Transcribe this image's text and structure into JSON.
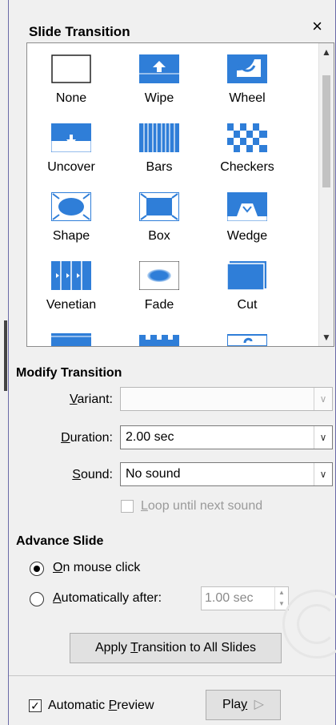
{
  "panel": {
    "title": "Slide Transition",
    "close_glyph": "×"
  },
  "transitions": [
    {
      "label": "None",
      "icon": "none-transition-icon"
    },
    {
      "label": "Wipe",
      "icon": "wipe-transition-icon"
    },
    {
      "label": "Wheel",
      "icon": "wheel-transition-icon"
    },
    {
      "label": "Uncover",
      "icon": "uncover-transition-icon"
    },
    {
      "label": "Bars",
      "icon": "bars-transition-icon"
    },
    {
      "label": "Checkers",
      "icon": "checkers-transition-icon"
    },
    {
      "label": "Shape",
      "icon": "shape-transition-icon"
    },
    {
      "label": "Box",
      "icon": "box-transition-icon"
    },
    {
      "label": "Wedge",
      "icon": "wedge-transition-icon"
    },
    {
      "label": "Venetian",
      "icon": "venetian-transition-icon"
    },
    {
      "label": "Fade",
      "icon": "fade-transition-icon"
    },
    {
      "label": "Cut",
      "icon": "cut-transition-icon"
    }
  ],
  "modify": {
    "heading": "Modify Transition",
    "variant_label": "Variant:",
    "variant_value": "",
    "duration_label": "Duration:",
    "duration_value": "2.00 sec",
    "sound_label": "Sound:",
    "sound_value": "No sound",
    "loop_label": "Loop until next sound",
    "loop_checked": false
  },
  "advance": {
    "heading": "Advance Slide",
    "on_click_label": "On mouse click",
    "on_click_selected": true,
    "auto_label": "Automatically after:",
    "auto_value": "1.00 sec",
    "apply_all_label": "Apply Transition to All Slides"
  },
  "footer": {
    "preview_label": "Automatic Preview",
    "preview_checked": true,
    "play_label": "Play",
    "play_glyph": "▷"
  },
  "colors": {
    "icon_blue": "#2f7ed8",
    "frame_border": "#6a6aa8"
  }
}
